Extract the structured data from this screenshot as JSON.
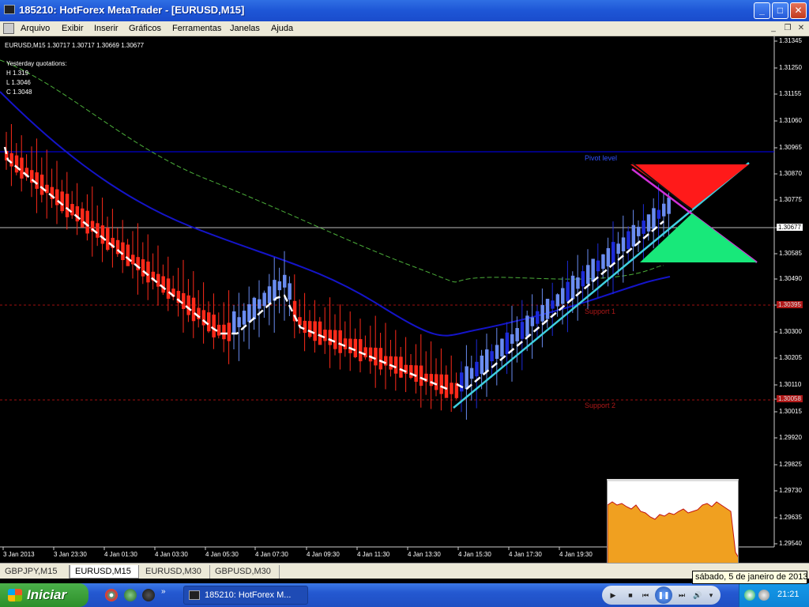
{
  "window": {
    "title": "185210: HotForex MetaTrader - [EURUSD,M15]",
    "controls": [
      "_",
      "□",
      "✕"
    ]
  },
  "menu": [
    "Arquivo",
    "Exibir",
    "Inserir",
    "Gráficos",
    "Ferramentas",
    "Janelas",
    "Ajuda"
  ],
  "mdi_controls": [
    "_",
    "❐",
    "✕"
  ],
  "chart": {
    "header": "EURUSD,M15  1.30717 1.30717 1.30669 1.30677",
    "yesterday": {
      "title": "Yesterday quotations:",
      "h": "H 1.319",
      "l": "L 1.3046",
      "c": "C 1.3048"
    },
    "levels": {
      "pivot": "Pivot level",
      "support1": "Support 1",
      "support2": "Support 2"
    },
    "price_ticks": [
      "1.31345",
      "1.31250",
      "1.31155",
      "1.31060",
      "1.30965",
      "1.30870",
      "1.30775",
      "1.30677",
      "1.30585",
      "1.30490",
      "1.30395",
      "1.30300",
      "1.30205",
      "1.30110",
      "1.30058",
      "1.30015",
      "1.29920",
      "1.29825",
      "1.29730",
      "1.29635",
      "1.29540"
    ],
    "current_price": "1.30677",
    "pivot_price": "1.30955",
    "support1_price": "1.30395",
    "support2_price": "1.30058",
    "time_ticks": [
      "3 Jan 2013",
      "3 Jan 23:30",
      "4 Jan 01:30",
      "4 Jan 03:30",
      "4 Jan 05:30",
      "4 Jan 07:30",
      "4 Jan 09:30",
      "4 Jan 11:30",
      "4 Jan 13:30",
      "4 Jan 15:30",
      "4 Jan 17:30",
      "4 Jan 19:30"
    ]
  },
  "tabs": [
    {
      "label": "GBPJPY,M15",
      "active": false
    },
    {
      "label": "EURUSD,M15",
      "active": true
    },
    {
      "label": "EURUSD,M30",
      "active": false
    },
    {
      "label": "GBPUSD,M30",
      "active": false
    }
  ],
  "taskbar": {
    "start": "Iniciar",
    "task_button": "185210: HotForex M...",
    "clock": "21:21",
    "tooltip": "sábado, 5 de janeiro de 2013"
  },
  "colors": {
    "bear": "#ff2a1a",
    "bull": "#1c2bd8",
    "ha_bull": "#6a8cf0",
    "ma_blue": "#1414c8",
    "ma_green": "#4caf3a",
    "trend": "#3fd0e0",
    "pivot_line": "#0000ff",
    "support": "#a01010"
  }
}
